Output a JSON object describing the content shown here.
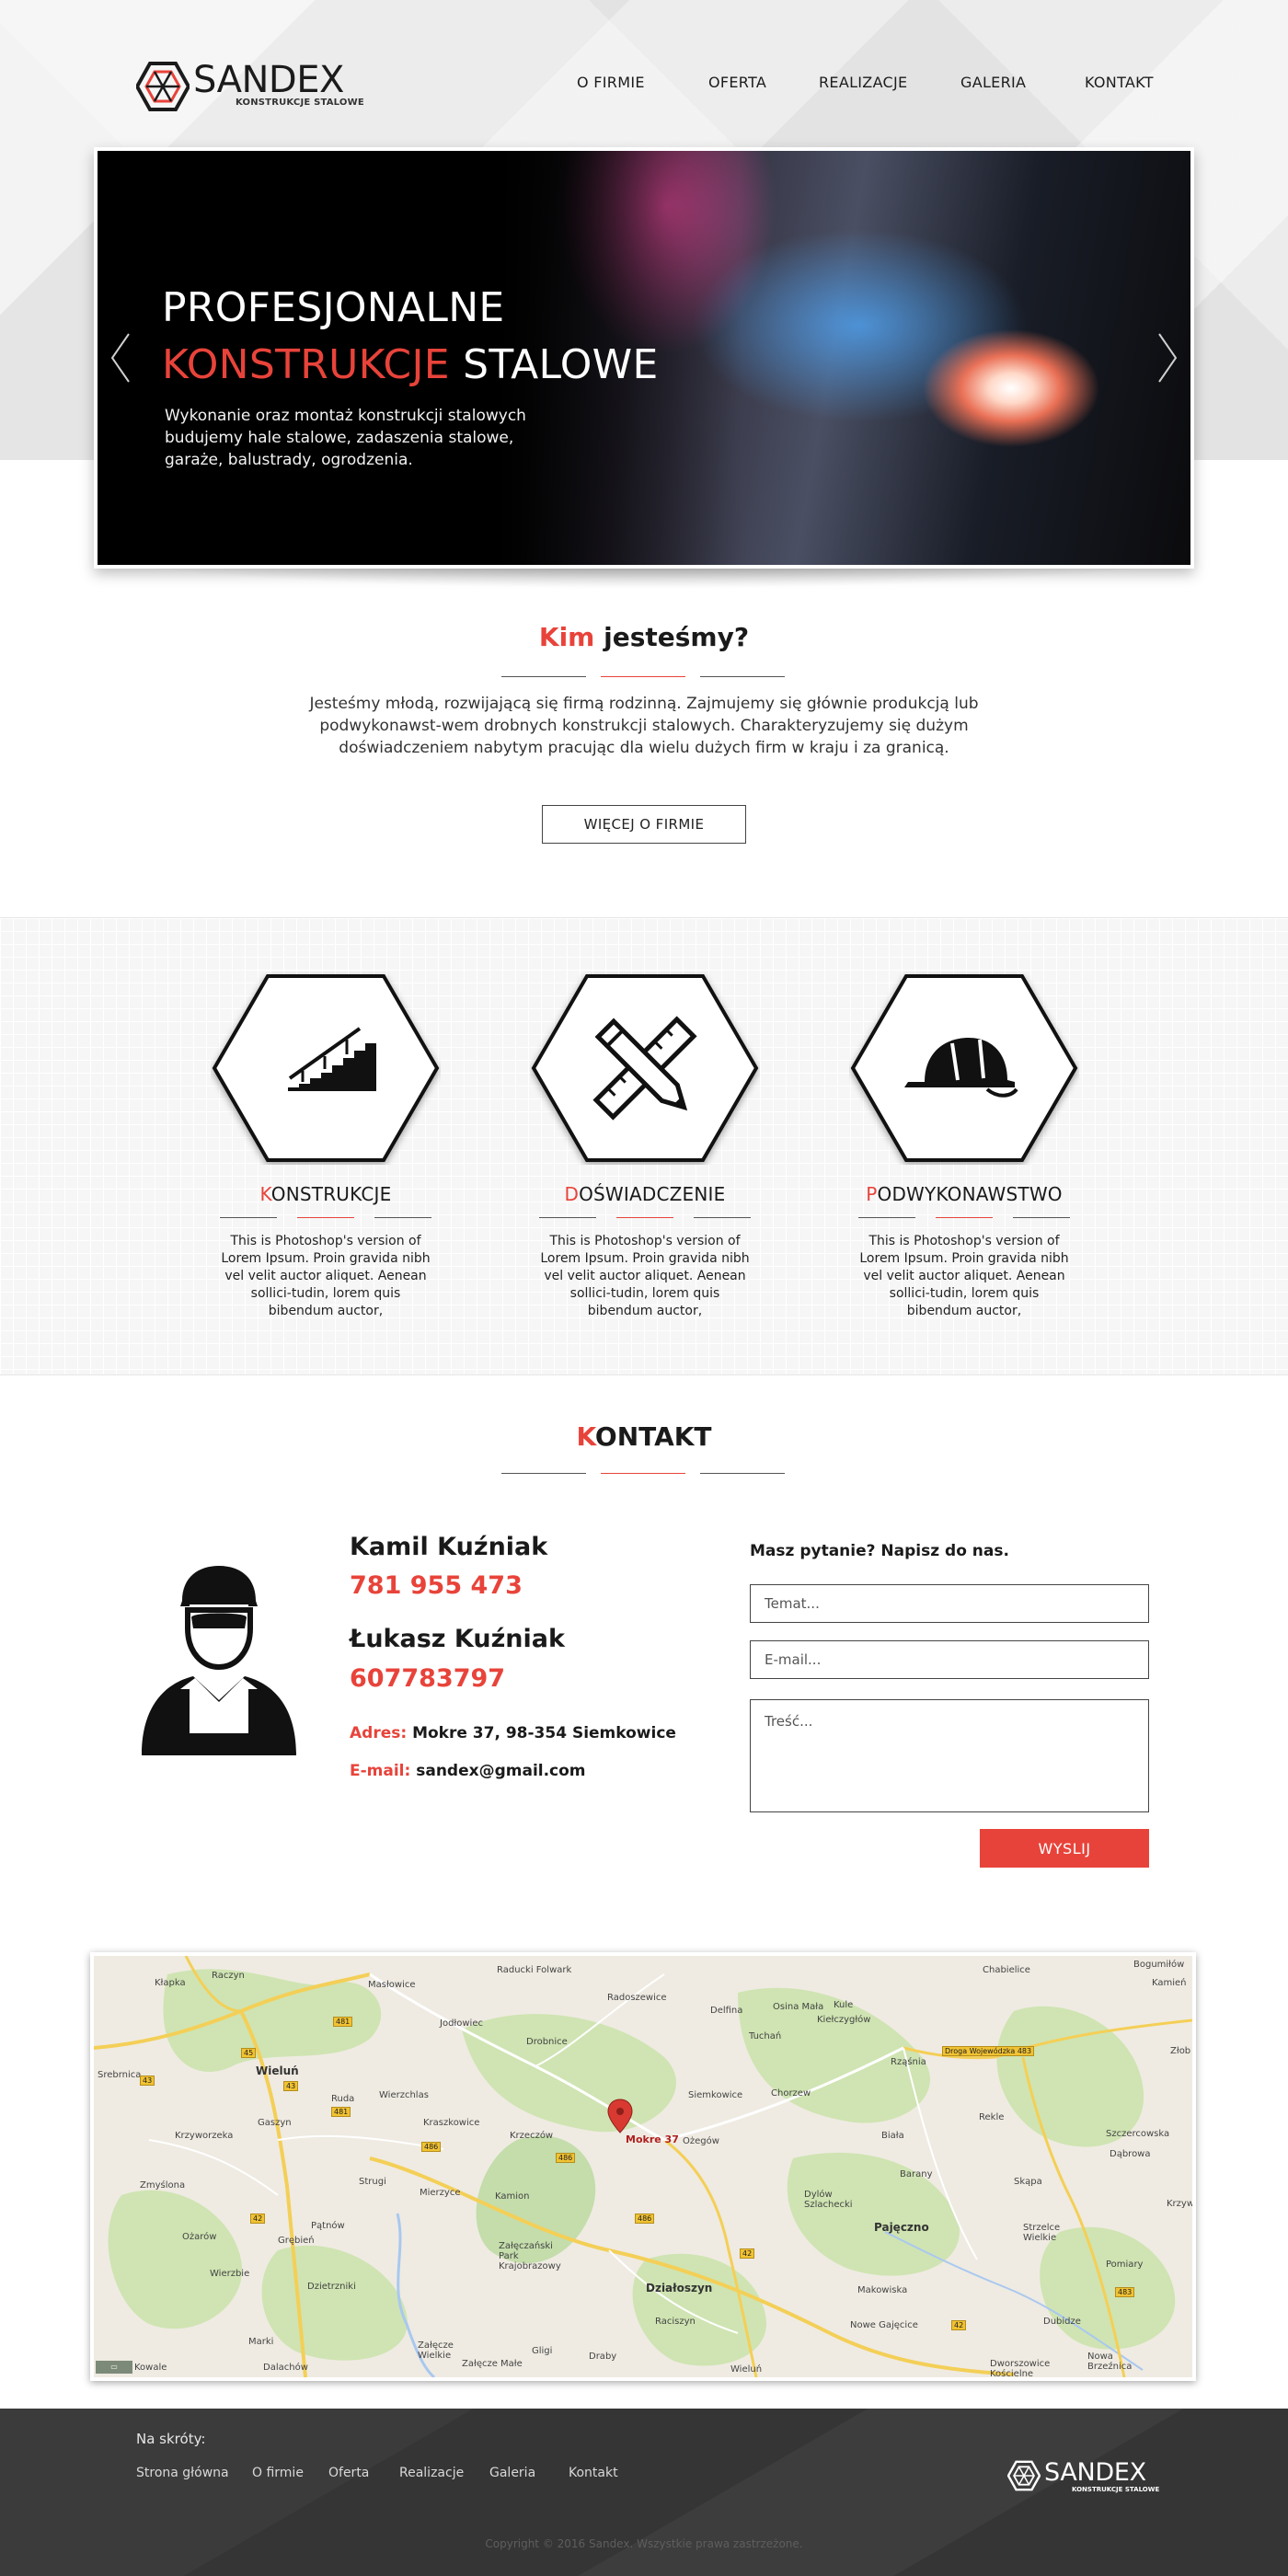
{
  "brand": {
    "name": "SANDEX",
    "tagline": "KONSTRUKCJE STALOWE",
    "accent_color": "#e8433a"
  },
  "nav": {
    "items": [
      "O FIRMIE",
      "OFERTA",
      "REALIZACJE",
      "GALERIA",
      "KONTAKT"
    ]
  },
  "hero": {
    "title_line1": "PROFESJONALNE",
    "title_accent": "KONSTRUKCJE",
    "title_rest": " STALOWE",
    "description": "Wykonanie oraz montaż konstrukcji stalowych budujemy hale stalowe, zadaszenia stalowe, garaże, balustrady, ogrodzenia.",
    "prev_icon": "chevron-left-icon",
    "next_icon": "chevron-right-icon"
  },
  "about": {
    "title_accent": "Kim",
    "title_rest": " jesteśmy?",
    "text": "Jesteśmy młodą, rozwijającą się firmą rodzinną. Zajmujemy się głównie produkcją lub podwykonawst-wem drobnych konstrukcji stalowych. Charakteryzujemy się dużym doświadczeniem nabytym pracując dla wielu dużych firm w kraju i za granicą.",
    "button": "WIĘCEJ  O FIRMIE"
  },
  "features": [
    {
      "first": "K",
      "rest": "ONSTRUKCJE",
      "icon": "stairs-icon",
      "text": "This is Photoshop's version  of Lorem Ipsum. Proin gravida nibh vel velit auctor aliquet. Aenean sollici-tudin, lorem quis bibendum auctor,"
    },
    {
      "first": "D",
      "rest": "OŚWIADCZENIE",
      "icon": "ruler-pencil-icon",
      "text": "This is Photoshop's version  of Lorem Ipsum. Proin gravida nibh vel velit auctor aliquet. Aenean sollici-tudin, lorem quis bibendum auctor,"
    },
    {
      "first": "P",
      "rest": "ODWYKONAWSTWO",
      "icon": "hard-hat-icon",
      "text": "This is Photoshop's version  of Lorem Ipsum. Proin gravida nibh vel velit auctor aliquet. Aenean sollici-tudin, lorem quis bibendum auctor,"
    }
  ],
  "contact": {
    "title_accent": "K",
    "title_rest": "ONTAKT",
    "persons": [
      {
        "name": "Kamil Kuźniak",
        "phone": "781 955 473"
      },
      {
        "name": "Łukasz Kuźniak",
        "phone": "607783797"
      }
    ],
    "address_label": "Adres:",
    "address": " Mokre 37, 98-354 Siemkowice",
    "email_label": "E-mail:",
    "email": " sandex@gmail.com",
    "form": {
      "title": "Masz pytanie? Napisz do nas.",
      "subject_placeholder": "Temat...",
      "email_placeholder": "E-mail...",
      "message_placeholder": "Treść...",
      "submit": "WYSLIJ"
    }
  },
  "map": {
    "marker_label": "Mokre 37",
    "labels": [
      "Kłapka",
      "Raczyn",
      "Masłowice",
      "Radoszewice",
      "Delfina",
      "Osina Mała",
      "Kule",
      "Kiełczygłów",
      "Tuchań",
      "Drobnice",
      "Jodłowiec",
      "Raducki Folwark",
      "Chabielice",
      "Bogumiłów",
      "Kamień",
      "Wieluń",
      "Srebrnica",
      "Ruda",
      "Wierzchlas",
      "Krzyworzeka",
      "Gaszyn",
      "Kraszkowice",
      "Krzeczów",
      "Siemkowice",
      "Chorzew",
      "Rząśnia",
      "Biała",
      "Rekle",
      "Zmyślona",
      "Strugi",
      "Mierzyce",
      "Ożegów",
      "Barany",
      "Skąpa",
      "Ożarów",
      "Pątnów",
      "Grębień",
      "Kamion",
      "Załęczański Park Krajobrazowy",
      "Dylów Szlachecki",
      "Pajęczno",
      "Strzelce Wielkie",
      "Wierzbie",
      "Dzietrzniki",
      "Działoszyn",
      "Makowiska",
      "Pomiary",
      "Marki",
      "Załęcze Wielkie",
      "Raciszyn",
      "Nowe Gajęcice",
      "Dubidze",
      "Dalachów",
      "Załęcze Małe",
      "Gligi",
      "Draby",
      "Dworszowice Kościelne",
      "Nowa Brzeźnica",
      "Kowale",
      "Wieluń",
      "Złob",
      "Krzyw",
      "Dąbrowa",
      "Szczercowska"
    ],
    "road_badges": [
      "481",
      "45",
      "43",
      "43",
      "481",
      "486",
      "486",
      "486",
      "42",
      "42",
      "42",
      "483"
    ],
    "road_name": "Droga Wojewódzka 483"
  },
  "footer": {
    "shortcuts_title": "Na skróty:",
    "links": [
      "Strona główna",
      "O firmie",
      "Oferta",
      "Realizacje",
      "Galeria",
      "Kontakt"
    ],
    "copyright": "Copyright  © 2016 Sandex. Wszystkie prawa zastrzeżone."
  }
}
